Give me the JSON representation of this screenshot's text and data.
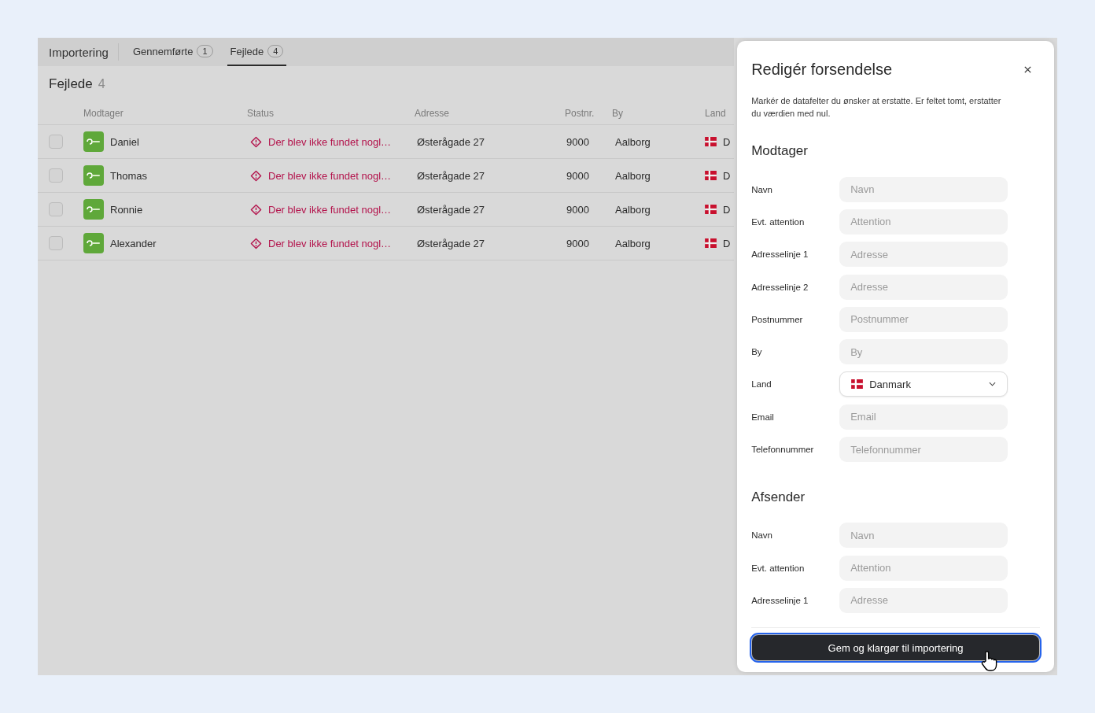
{
  "tabs": {
    "title": "Importering",
    "items": [
      {
        "label": "Gennemførte",
        "count": "1",
        "selected": false
      },
      {
        "label": "Fejlede",
        "count": "4",
        "selected": true
      }
    ]
  },
  "list": {
    "title": "Fejlede",
    "count": "4",
    "columns": [
      "Modtager",
      "Status",
      "Adresse",
      "Postnr.",
      "By",
      "Land"
    ],
    "rows": [
      {
        "checked": false,
        "recipient": "Daniel",
        "status": "Der blev ikke fundet nogl…",
        "address": "Østerågade 27",
        "postal": "9000",
        "city": "Aalborg",
        "country": "D"
      },
      {
        "checked": false,
        "recipient": "Thomas",
        "status": "Der blev ikke fundet nogl…",
        "address": "Østerågade 27",
        "postal": "9000",
        "city": "Aalborg",
        "country": "D"
      },
      {
        "checked": false,
        "recipient": "Ronnie",
        "status": "Der blev ikke fundet nogl…",
        "address": "Østerågade 27",
        "postal": "9000",
        "city": "Aalborg",
        "country": "D"
      },
      {
        "checked": false,
        "recipient": "Alexander",
        "status": "Der blev ikke fundet nogl…",
        "address": "Østerågade 27",
        "postal": "9000",
        "city": "Aalborg",
        "country": "D"
      }
    ]
  },
  "panel": {
    "title": "Redigér forsendelse",
    "description": "Markér de datafelter du ønsker at erstatte. Er feltet tomt, erstatter du værdien med nul.",
    "sections": [
      {
        "title": "Modtager",
        "fields": [
          {
            "kind": "input",
            "label": "Navn",
            "placeholder": "Navn"
          },
          {
            "kind": "input",
            "label": "Evt. attention",
            "placeholder": "Attention"
          },
          {
            "kind": "input",
            "label": "Adresselinje 1",
            "placeholder": "Adresse"
          },
          {
            "kind": "input",
            "label": "Adresselinje 2",
            "placeholder": "Adresse"
          },
          {
            "kind": "input",
            "label": "Postnummer",
            "placeholder": "Postnummer"
          },
          {
            "kind": "input",
            "label": "By",
            "placeholder": "By"
          },
          {
            "kind": "select",
            "label": "Land",
            "value": "Danmark"
          },
          {
            "kind": "input",
            "label": "Email",
            "placeholder": "Email"
          },
          {
            "kind": "input",
            "label": "Telefonnummer",
            "placeholder": "Telefonnummer"
          }
        ]
      },
      {
        "title": "Afsender",
        "fields": [
          {
            "kind": "input",
            "label": "Navn",
            "placeholder": "Navn"
          },
          {
            "kind": "input",
            "label": "Evt. attention",
            "placeholder": "Attention"
          },
          {
            "kind": "input",
            "label": "Adresselinje 1",
            "placeholder": "Adresse"
          }
        ]
      }
    ],
    "submit": "Gem og klargør til importering"
  }
}
